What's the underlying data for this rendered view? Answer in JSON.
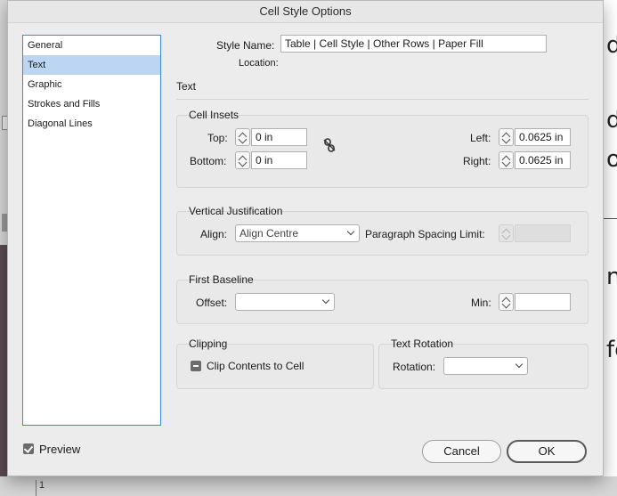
{
  "dialog": {
    "title": "Cell Style Options"
  },
  "categories": [
    {
      "label": "General",
      "selected": false
    },
    {
      "label": "Text",
      "selected": true
    },
    {
      "label": "Graphic",
      "selected": false
    },
    {
      "label": "Strokes and Fills",
      "selected": false
    },
    {
      "label": "Diagonal Lines",
      "selected": false
    }
  ],
  "header": {
    "style_name_label": "Style Name:",
    "style_name_value": "Table | Cell Style | Other Rows | Paper Fill",
    "location_label": "Location:",
    "section_title": "Text"
  },
  "cell_insets": {
    "title": "Cell Insets",
    "top_label": "Top:",
    "top_value": "0 in",
    "bottom_label": "Bottom:",
    "bottom_value": "0 in",
    "left_label": "Left:",
    "left_value": "0.0625 in",
    "right_label": "Right:",
    "right_value": "0.0625 in",
    "link_icon": "broken-chain-icon"
  },
  "vertical_justification": {
    "title": "Vertical Justification",
    "align_label": "Align:",
    "align_value": "Align Centre",
    "para_spacing_label": "Paragraph Spacing Limit:"
  },
  "first_baseline": {
    "title": "First Baseline",
    "offset_label": "Offset:",
    "offset_value": "",
    "min_label": "Min:",
    "min_value": ""
  },
  "clipping": {
    "title": "Clipping",
    "clip_label": "Clip Contents to Cell",
    "clip_state": "mixed"
  },
  "text_rotation": {
    "title": "Text Rotation",
    "rotation_label": "Rotation:",
    "rotation_value": ""
  },
  "footer": {
    "preview_label": "Preview",
    "preview_checked": true,
    "cancel_label": "Cancel",
    "ok_label": "OK"
  },
  "background": {
    "glyphs": [
      "d",
      "d",
      "o",
      "n",
      "fe"
    ],
    "ruler_text": "1"
  }
}
